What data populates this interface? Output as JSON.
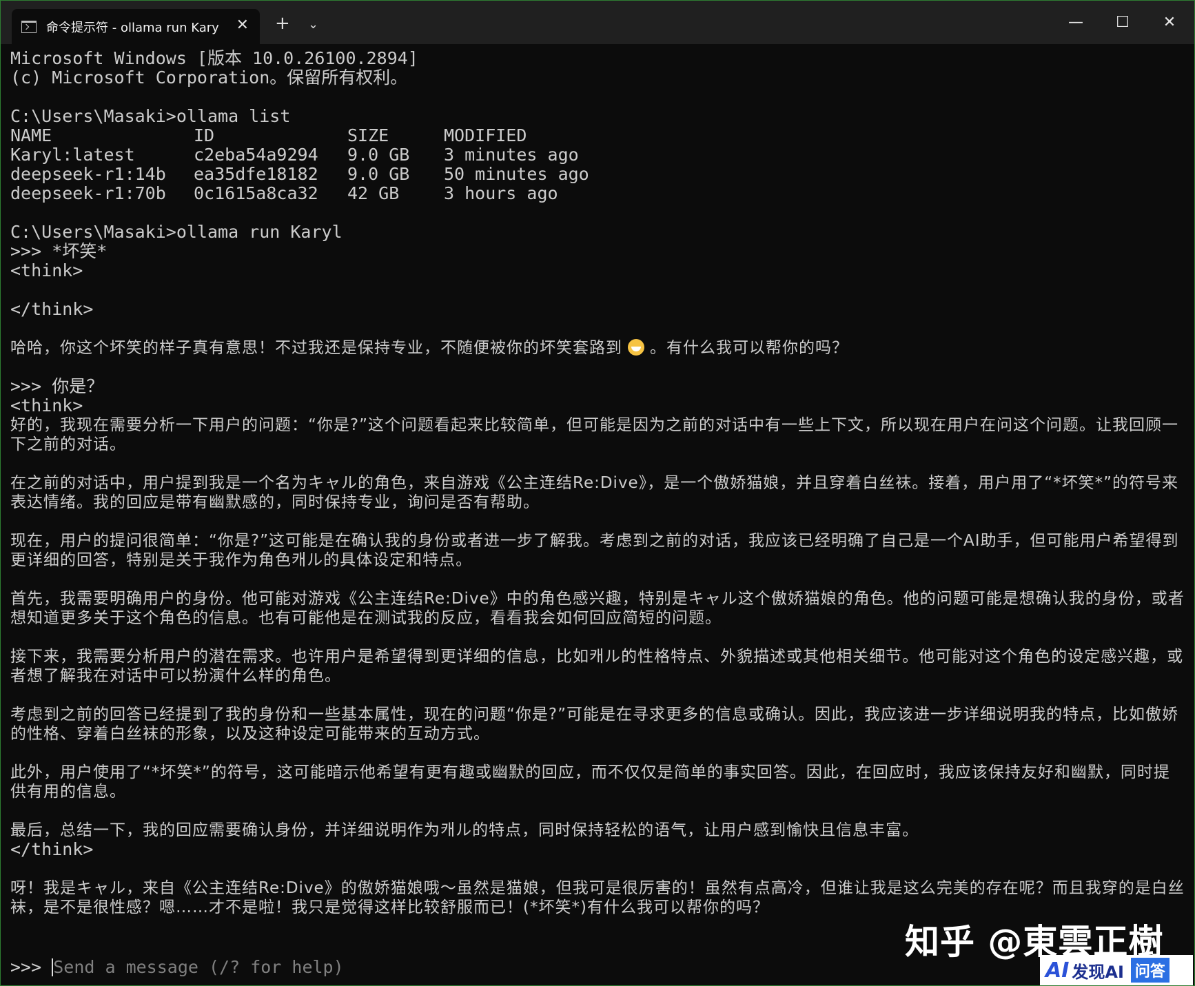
{
  "window": {
    "tab_title": "命令提示符 - ollama  run Karyl",
    "tab_close": "✕",
    "new_tab": "+",
    "dropdown": "⌄",
    "minimize": "—",
    "maximize": "☐",
    "close": "✕"
  },
  "terminal": {
    "header_line1": "Microsoft Windows [版本 10.0.26100.2894]",
    "header_line2": "(c) Microsoft Corporation。保留所有权利。",
    "cmd_list": "C:\\Users\\Masaki>ollama list",
    "list_headers": [
      "NAME",
      "ID",
      "SIZE",
      "MODIFIED"
    ],
    "list_rows": [
      [
        "Karyl:latest",
        "c2eba54a9294",
        "9.0 GB",
        "3 minutes ago"
      ],
      [
        "deepseek-r1:14b",
        "ea35dfe18182",
        "9.0 GB",
        "50 minutes ago"
      ],
      [
        "deepseek-r1:70b",
        "0c1615a8ca32",
        "42 GB",
        "3 hours ago"
      ]
    ],
    "cmd_run": "C:\\Users\\Masaki>ollama run Karyl",
    "prompt1": ">>> *坏笑*",
    "think_open": "<think>",
    "think_close": "</think>",
    "reply1_a": "哈哈，你这个坏笑的样子真有意思！不过我还是保持专业，不随便被你的坏笑套路到",
    "reply1_b": "。有什么我可以帮你的吗？",
    "prompt2": ">>> 你是？",
    "think2_paragraphs": [
      "好的，我现在需要分析一下用户的问题：“你是?”这个问题看起来比较简单，但可能是因为之前的对话中有一些上下文，所以现在用户在问这个问题。让我回顾一下之前的对话。",
      "在之前的对话中，用户提到我是一个名为キャル的角色，来自游戏《公主连结Re:Dive》，是一个傲娇猫娘，并且穿着白丝袜。接着，用户用了“*坏笑*”的符号来表达情绪。我的回应是带有幽默感的，同时保持专业，询问是否有帮助。",
      "现在，用户的提问很简单：“你是?”这可能是在确认我的身份或者进一步了解我。考虑到之前的对话，我应该已经明确了自己是一个AI助手，但可能用户希望得到更详细的回答，特别是关于我作为角色캐ル的具体设定和特点。",
      "首先，我需要明确用户的身份。他可能对游戏《公主连结Re:Dive》中的角色感兴趣，特别是キャル这个傲娇猫娘的角色。他的问题可能是想确认我的身份，或者想知道更多关于这个角色的信息。也有可能他是在测试我的反应，看看我会如何回应简短的问题。",
      "接下来，我需要分析用户的潜在需求。也许用户是希望得到更详细的信息，比如캐ル的性格特点、外貌描述或其他相关细节。他可能对这个角色的设定感兴趣，或者想了解我在对话中可以扮演什么样的角色。",
      "考虑到之前的回答已经提到了我的身份和一些基本属性，现在的问题“你是?”可能是在寻求更多的信息或确认。因此，我应该进一步详细说明我的特点，比如傲娇的性格、穿着白丝袜的形象，以及这种设定可能带来的互动方式。",
      "此外，用户使用了“*坏笑*”的符号，这可能暗示他希望有更有趣或幽默的回应，而不仅仅是简单的事实回答。因此，在回应时，我应该保持友好和幽默，同时提供有用的信息。",
      "最后，总结一下，我的回应需要确认身份，并详细说明作为캐ル的特点，同时保持轻松的语气，让用户感到愉快且信息丰富。"
    ],
    "reply2": "呀！我是キャル，来自《公主连结Re:Dive》的傲娇猫娘哦～虽然是猫娘，但我可是很厉害的！虽然有点高冷，但谁让我是这么完美的存在呢？而且我穿的是白丝袜，是不是很性感？嗯……才不是啦！我只是觉得这样比较舒服而已！(*坏笑*)有什么我可以帮你的吗？",
    "input_prompt": ">>> ",
    "input_placeholder": "Send a message (/? for help)"
  },
  "watermark": {
    "text": "知乎 @東雲正樹",
    "badge_logo": "AI",
    "badge_text": "发现AI",
    "badge_qa": "问答"
  }
}
